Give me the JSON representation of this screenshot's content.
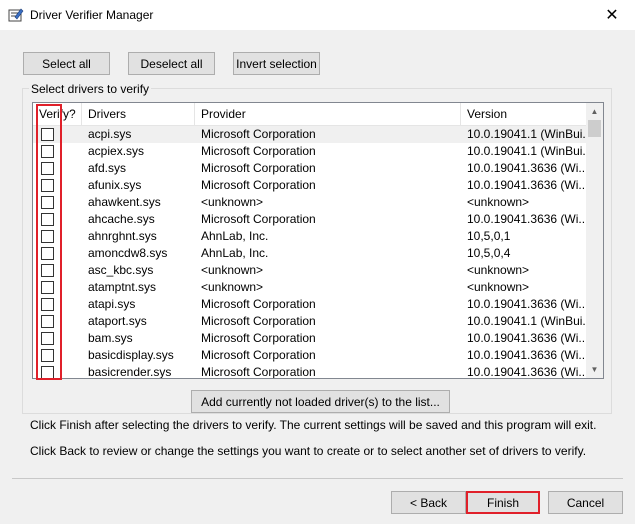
{
  "window": {
    "title": "Driver Verifier Manager",
    "close_glyph": "✕",
    "icon": "driver-verifier-icon"
  },
  "toolbar": {
    "select_all": "Select all",
    "deselect_all": "Deselect all",
    "invert_selection": "Invert selection"
  },
  "group": {
    "label": "Select drivers to verify"
  },
  "list": {
    "columns": [
      "Verify?",
      "Drivers",
      "Provider",
      "Version"
    ],
    "rows": [
      {
        "driver": "acpi.sys",
        "provider": "Microsoft Corporation",
        "version": "10.0.19041.1 (WinBui..."
      },
      {
        "driver": "acpiex.sys",
        "provider": "Microsoft Corporation",
        "version": "10.0.19041.1 (WinBui..."
      },
      {
        "driver": "afd.sys",
        "provider": "Microsoft Corporation",
        "version": "10.0.19041.3636 (Wi..."
      },
      {
        "driver": "afunix.sys",
        "provider": "Microsoft Corporation",
        "version": "10.0.19041.3636 (Wi..."
      },
      {
        "driver": "ahawkent.sys",
        "provider": "<unknown>",
        "version": "<unknown>"
      },
      {
        "driver": "ahcache.sys",
        "provider": "Microsoft Corporation",
        "version": "10.0.19041.3636 (Wi..."
      },
      {
        "driver": "ahnrghnt.sys",
        "provider": "AhnLab, Inc.",
        "version": "10,5,0,1"
      },
      {
        "driver": "amoncdw8.sys",
        "provider": "AhnLab, Inc.",
        "version": "10,5,0,4"
      },
      {
        "driver": "asc_kbc.sys",
        "provider": "<unknown>",
        "version": "<unknown>"
      },
      {
        "driver": "atamptnt.sys",
        "provider": "<unknown>",
        "version": "<unknown>"
      },
      {
        "driver": "atapi.sys",
        "provider": "Microsoft Corporation",
        "version": "10.0.19041.3636 (Wi..."
      },
      {
        "driver": "ataport.sys",
        "provider": "Microsoft Corporation",
        "version": "10.0.19041.1 (WinBui..."
      },
      {
        "driver": "bam.sys",
        "provider": "Microsoft Corporation",
        "version": "10.0.19041.3636 (Wi..."
      },
      {
        "driver": "basicdisplay.sys",
        "provider": "Microsoft Corporation",
        "version": "10.0.19041.3636 (Wi..."
      },
      {
        "driver": "basicrender.sys",
        "provider": "Microsoft Corporation",
        "version": "10.0.19041.3636 (Wi..."
      }
    ],
    "scroll_up": "▲",
    "scroll_down": "▼"
  },
  "add_button": "Add currently not loaded driver(s) to the list...",
  "info": {
    "line1": "Click Finish after selecting the drivers to verify. The current settings will be saved and this program will exit.",
    "line2": "Click Back to review or change the settings you want to create or to select another set of drivers to verify."
  },
  "footer": {
    "back": "< Back",
    "finish": "Finish",
    "cancel": "Cancel"
  },
  "colors": {
    "highlight": "#e0202a",
    "window_bg": "#f0f0f0"
  }
}
